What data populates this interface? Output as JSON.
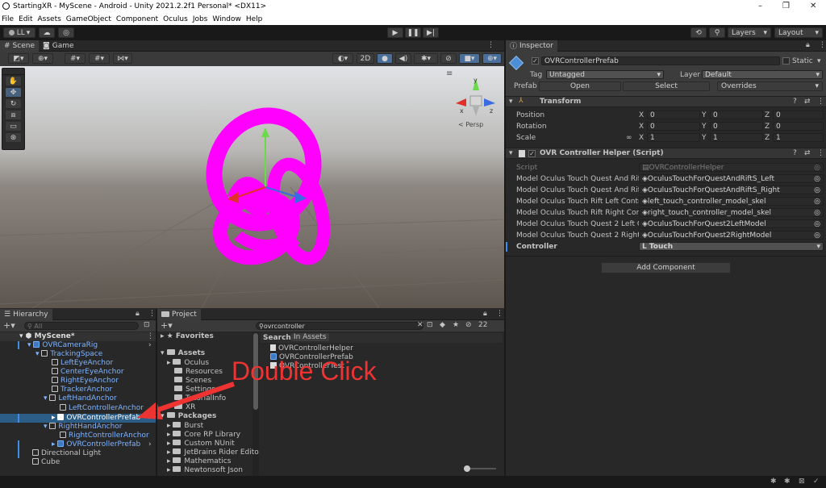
{
  "title_bar": {
    "title": "StartingXR - MyScene - Android - Unity 2021.2.2f1 Personal* <DX11>",
    "minimize": "–",
    "maximize": "❐",
    "close": "✕"
  },
  "menu": [
    "File",
    "Edit",
    "Assets",
    "GameObject",
    "Component",
    "Oculus",
    "Jobs",
    "Window",
    "Help"
  ],
  "toolbar": {
    "account": "LL",
    "layers": "Layers",
    "layout": "Layout"
  },
  "scene_tabs": {
    "scene": "Scene",
    "game": "Game"
  },
  "scene_view": {
    "mode": "2D",
    "persp": "< Persp",
    "axis_y": "y",
    "axis_x": "x",
    "axis_z": "z"
  },
  "hierarchy": {
    "title": "Hierarchy",
    "search_placeholder": "All",
    "items": [
      {
        "label": "MyScene*"
      },
      {
        "label": "OVRCameraRig"
      },
      {
        "label": "TrackingSpace"
      },
      {
        "label": "LeftEyeAnchor"
      },
      {
        "label": "CenterEyeAnchor"
      },
      {
        "label": "RightEyeAnchor"
      },
      {
        "label": "TrackerAnchor"
      },
      {
        "label": "LeftHandAnchor"
      },
      {
        "label": "LeftControllerAnchor"
      },
      {
        "label": "OVRControllerPrefab"
      },
      {
        "label": "RightHandAnchor"
      },
      {
        "label": "RightControllerAnchor"
      },
      {
        "label": "OVRControllerPrefab"
      },
      {
        "label": "Directional Light"
      },
      {
        "label": "Cube"
      }
    ]
  },
  "project": {
    "title": "Project",
    "search_value": "ovrcontroller",
    "count": "22",
    "search_label": "Search:",
    "search_scope": "In Assets",
    "tree": [
      {
        "label": "Favorites"
      },
      {
        "label": "Assets"
      },
      {
        "label": "Oculus"
      },
      {
        "label": "Resources"
      },
      {
        "label": "Scenes"
      },
      {
        "label": "Settings"
      },
      {
        "label": "TutorialInfo"
      },
      {
        "label": "XR"
      },
      {
        "label": "Packages"
      },
      {
        "label": "Burst"
      },
      {
        "label": "Core RP Library"
      },
      {
        "label": "Custom NUnit"
      },
      {
        "label": "JetBrains Rider Edito"
      },
      {
        "label": "Mathematics"
      },
      {
        "label": "Newtonsoft Json"
      }
    ],
    "results": [
      "OVRControllerHelper",
      "OVRControllerPrefab",
      "OVRControllerTest"
    ]
  },
  "annotation": {
    "text": "Double Click",
    "color": "#ee3333"
  },
  "inspector": {
    "title": "Inspector",
    "object_name": "OVRControllerPrefab",
    "static_label": "Static",
    "tag_label": "Tag",
    "tag_value": "Untagged",
    "layer_label": "Layer",
    "layer_value": "Default",
    "prefab_label": "Prefab",
    "open": "Open",
    "select": "Select",
    "overrides": "Overrides",
    "transform": {
      "title": "Transform",
      "position": {
        "label": "Position",
        "x": "0",
        "y": "0",
        "z": "0"
      },
      "rotation": {
        "label": "Rotation",
        "x": "0",
        "y": "0",
        "z": "0"
      },
      "scale": {
        "label": "Scale",
        "x": "1",
        "y": "1",
        "z": "1"
      }
    },
    "script_component": {
      "title": "OVR Controller Helper (Script)",
      "script_label": "Script",
      "script_value": "OVRControllerHelper",
      "fields": [
        {
          "label": "Model Oculus Touch Quest And Rift S",
          "value": "OculusTouchForQuestAndRiftS_Left"
        },
        {
          "label": "Model Oculus Touch Quest And Rift S",
          "value": "OculusTouchForQuestAndRiftS_Right"
        },
        {
          "label": "Model Oculus Touch Rift Left Controll",
          "value": "left_touch_controller_model_skel"
        },
        {
          "label": "Model Oculus Touch Rift Right Contro",
          "value": "right_touch_controller_model_skel"
        },
        {
          "label": "Model Oculus Touch Quest 2 Left Co",
          "value": "OculusTouchForQuest2LeftModel"
        },
        {
          "label": "Model Oculus Touch Quest 2 Right Co",
          "value": "OculusTouchForQuest2RightModel"
        }
      ],
      "controller_label": "Controller",
      "controller_value": "L Touch"
    },
    "add_component": "Add Component"
  }
}
